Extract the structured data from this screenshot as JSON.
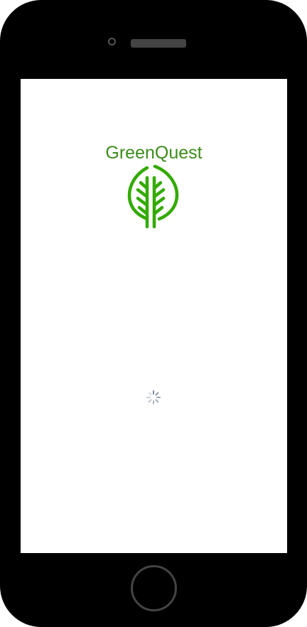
{
  "app": {
    "name": "GreenQuest"
  },
  "loading": {
    "state": "loading"
  },
  "colors": {
    "brand": "#3d8c1c",
    "logo": "#33aa00",
    "device_frame": "#000000",
    "screen_background": "#ffffff",
    "spinner": "#7a8a9e"
  },
  "icons": {
    "logo": "leaf-icon",
    "spinner": "loading-spinner-icon",
    "home": "home-button"
  }
}
